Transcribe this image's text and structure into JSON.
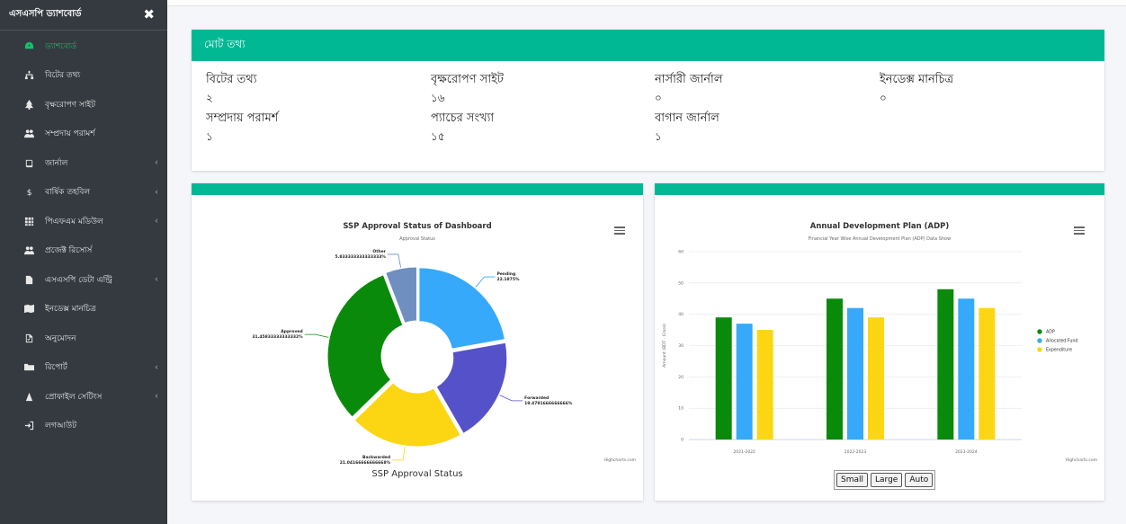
{
  "sidebar": {
    "brand": "এসএসপি ড্যাশবোর্ড",
    "close_icon": "close-icon",
    "items": [
      {
        "label": "ড্যাশবোর্ড",
        "icon": "dashboard-icon",
        "active": true,
        "has_children": false
      },
      {
        "label": "বিটের তথ্য",
        "icon": "sitemap-icon",
        "active": false,
        "has_children": false
      },
      {
        "label": "বৃক্ষরোপণ সাইট",
        "icon": "tree-icon",
        "active": false,
        "has_children": false
      },
      {
        "label": "সম্প্রদায় পরামর্শ",
        "icon": "users-icon",
        "active": false,
        "has_children": false
      },
      {
        "label": "জার্নাল",
        "icon": "book-icon",
        "active": false,
        "has_children": true
      },
      {
        "label": "বার্ষিক তহবিল",
        "icon": "dollar-icon",
        "active": false,
        "has_children": true
      },
      {
        "label": "পিএফএম মডিউল",
        "icon": "grid-icon",
        "active": false,
        "has_children": true
      },
      {
        "label": "প্রজেক্ট রিসোর্স",
        "icon": "users-icon",
        "active": false,
        "has_children": false
      },
      {
        "label": "এসএসপি ডেটা এন্ট্রি",
        "icon": "file-icon",
        "active": false,
        "has_children": true
      },
      {
        "label": "ইনডেক্স মানচিত্র",
        "icon": "map-icon",
        "active": false,
        "has_children": false
      },
      {
        "label": "অনুমোদন",
        "icon": "file-check-icon",
        "active": false,
        "has_children": false
      },
      {
        "label": "রিপোর্ট",
        "icon": "folder-icon",
        "active": false,
        "has_children": true
      },
      {
        "label": "প্রোফাইল সেটিংস",
        "icon": "user-icon",
        "active": false,
        "has_children": true
      },
      {
        "label": "লগআউট",
        "icon": "logout-icon",
        "active": false,
        "has_children": false
      }
    ]
  },
  "summary": {
    "title": "মোট তথ্য",
    "items": [
      {
        "label": "বিটের তথ্য",
        "value": "২"
      },
      {
        "label": "বৃক্ষরোপণ সাইট",
        "value": "১৬"
      },
      {
        "label": "নার্সারী জার্নাল",
        "value": "০"
      },
      {
        "label": "ইনডেক্স মানচিত্র",
        "value": "০"
      },
      {
        "label": "সম্প্রদায় পরামর্শ",
        "value": "১"
      },
      {
        "label": "প্যাচের সংখ্যা",
        "value": "১৫"
      },
      {
        "label": "বাগান জার্নাল",
        "value": "১"
      }
    ]
  },
  "chart_data": [
    {
      "type": "pie",
      "title": "SSP Approval Status of Dashboard",
      "subtitle": "Approval Status",
      "footer_label": "SSP Approval Status",
      "credit": "Highcharts.com",
      "slices": [
        {
          "name": "Pending",
          "value": 22.1875,
          "label": "22.1875%",
          "color": "#36a9fa"
        },
        {
          "name": "Forwarded",
          "value": 19.4791666666666,
          "label": "19.4791666666666%",
          "color": "#5551c9"
        },
        {
          "name": "Backwarded",
          "value": 21.04166666666668,
          "label": "21.04166666666668%",
          "color": "#fcd612"
        },
        {
          "name": "Approved",
          "value": 31.45833333333332,
          "label": "31.45833333333332%",
          "color": "#0a8a0a"
        },
        {
          "name": "Other",
          "value": 5.833333333333333,
          "label": "5.833333333333333%",
          "color": "#6e8fbf"
        }
      ]
    },
    {
      "type": "bar",
      "title": "Annual Development Plan (ADP)",
      "subtitle": "Financial Year Wise Annual Development Plan (ADP) Data Show",
      "ylabel": "Amount (BDT - Crore)",
      "ylim": [
        0,
        60
      ],
      "yticks": [
        0,
        10,
        20,
        30,
        40,
        50,
        60
      ],
      "categories": [
        "2021-2022",
        "2022-2023",
        "2023-2024"
      ],
      "series": [
        {
          "name": "ADP",
          "values": [
            39,
            45,
            48
          ],
          "color": "#0a8a0a"
        },
        {
          "name": "Allocated Fund",
          "values": [
            37,
            42,
            45
          ],
          "color": "#36a9fa"
        },
        {
          "name": "Expenditure",
          "values": [
            35,
            39,
            42
          ],
          "color": "#fcd612"
        }
      ],
      "legend": "right",
      "credit": "Highcharts.com",
      "buttons": [
        "Small",
        "Large",
        "Auto"
      ]
    }
  ]
}
